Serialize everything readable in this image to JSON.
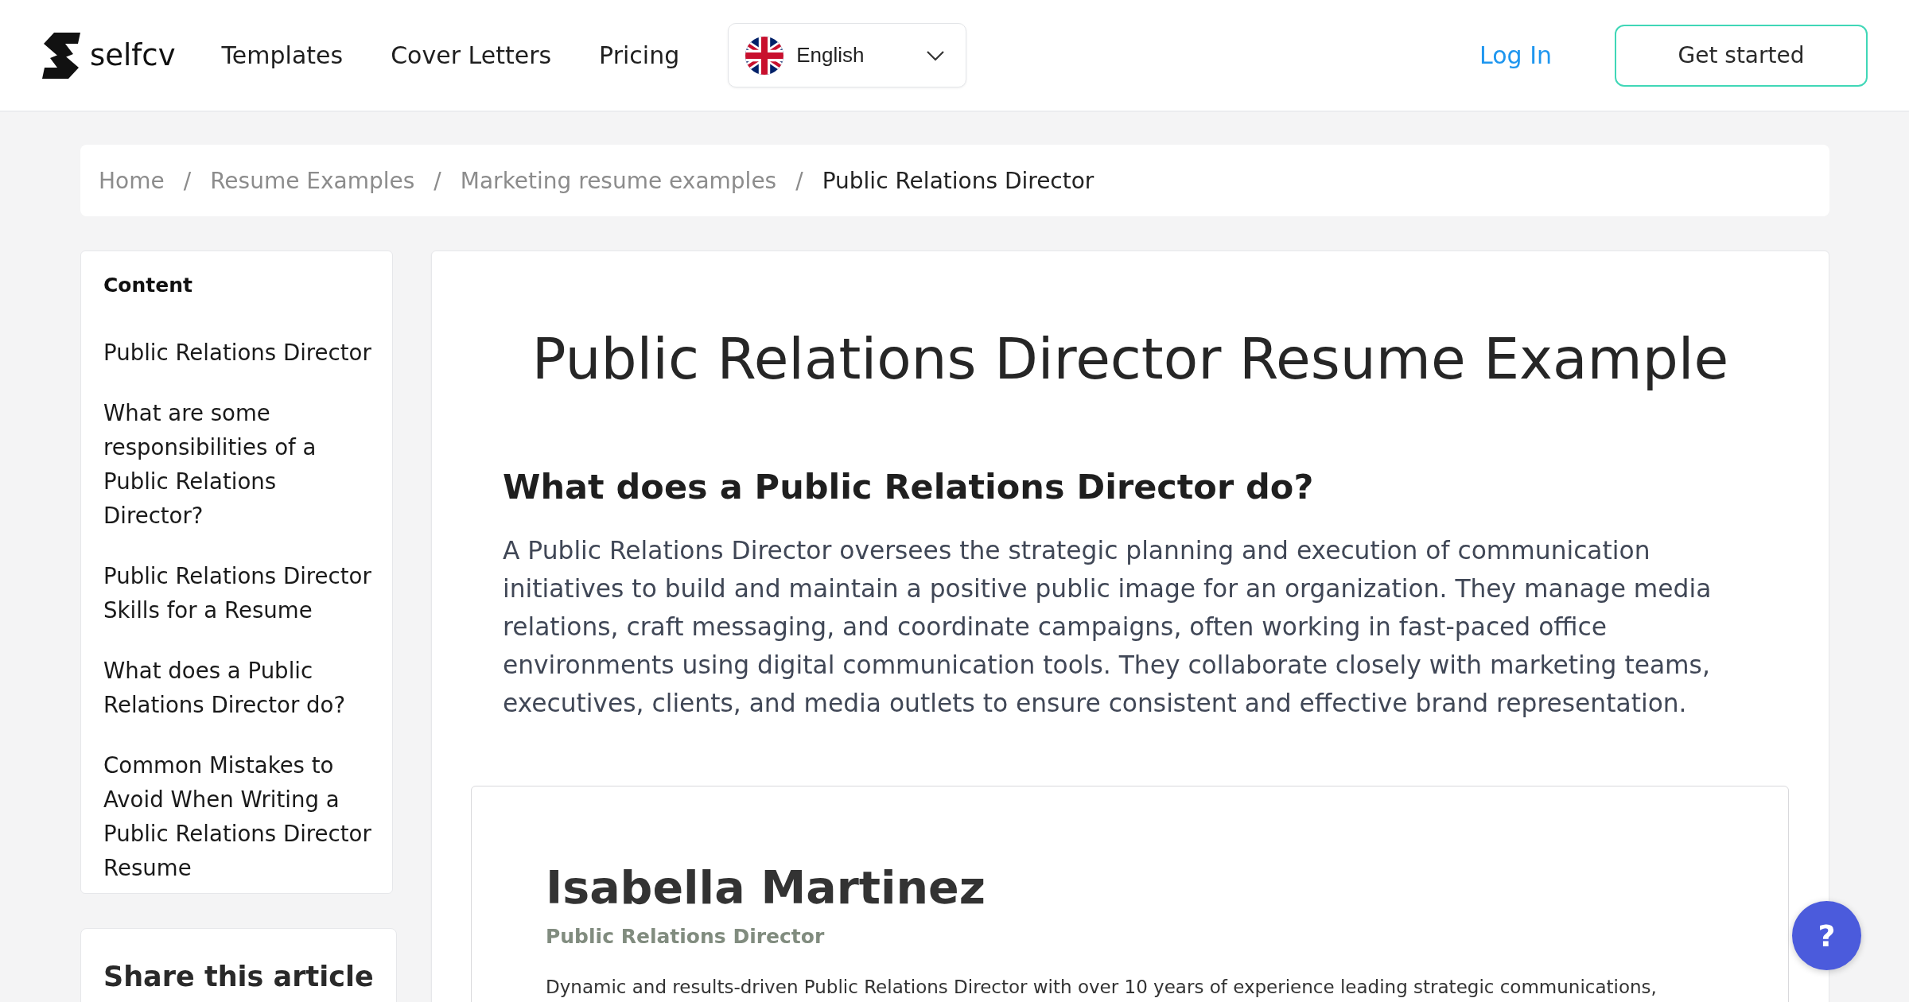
{
  "header": {
    "logo": {
      "text": "selfcv"
    },
    "nav": [
      {
        "label": "Templates"
      },
      {
        "label": "Cover Letters"
      },
      {
        "label": "Pricing"
      }
    ],
    "language": {
      "label": "English"
    },
    "login": {
      "label": "Log In"
    },
    "cta": {
      "label": "Get started"
    }
  },
  "breadcrumb": {
    "items": [
      {
        "label": "Home",
        "current": false
      },
      {
        "label": "Resume Examples",
        "current": false,
        "separator": "/"
      },
      {
        "label": "Marketing resume examples",
        "current": false,
        "separator": "/"
      },
      {
        "label": "Public Relations Director",
        "current": true,
        "separator": "/"
      }
    ]
  },
  "sidebar": {
    "title": "Content",
    "items": [
      "Public Relations Director",
      "What are some responsibilities of a Public Relations Director?",
      "Public Relations Director Skills for a Resume",
      "What does a Public Relations Director do?",
      "Common Mistakes to Avoid When Writing a Public Relations Director Resume"
    ]
  },
  "share": {
    "title": "Share this article"
  },
  "article": {
    "title": "Public Relations Director Resume Example",
    "sections": [
      {
        "heading": "What does a Public Relations Director do?",
        "body": "A Public Relations Director oversees the strategic planning and execution of communication initiatives to build and maintain a positive public image for an organization. They manage media relations, craft messaging, and coordinate campaigns, often working in fast-paced office environments using digital communication tools. They collaborate closely with marketing teams, executives, clients, and media outlets to ensure consistent and effective brand representation."
      }
    ],
    "resume_preview": {
      "name": "Isabella Martinez",
      "role": "Public Relations Director",
      "summary": "Dynamic and results-driven Public Relations Director with over 10 years of experience leading strategic communications,"
    }
  },
  "help_button": {
    "label": "?"
  }
}
